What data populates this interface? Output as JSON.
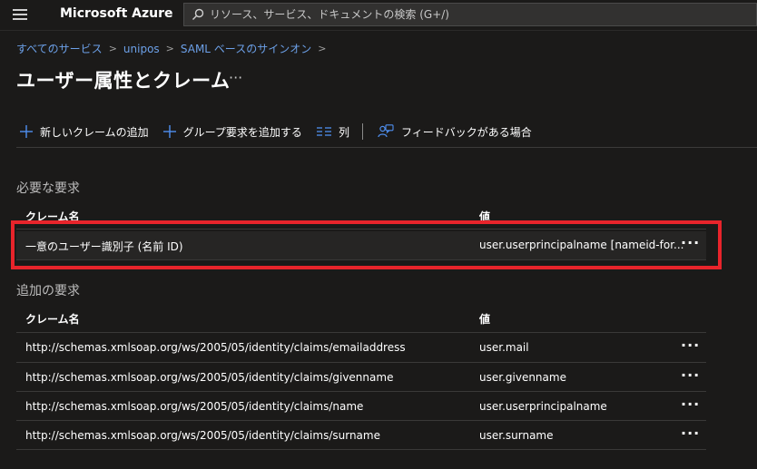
{
  "topbar": {
    "brand": "Microsoft Azure",
    "search_placeholder": "リソース、サービス、ドキュメントの検索 (G+/)"
  },
  "breadcrumb": {
    "items": [
      "すべてのサービス",
      "unipos",
      "SAML ベースのサインオン"
    ],
    "separator": ">"
  },
  "page": {
    "title": "ユーザー属性とクレーム",
    "more": "···"
  },
  "toolbar": {
    "add_claim": "新しいクレームの追加",
    "add_group_claim": "グループ要求を追加する",
    "columns": "列",
    "feedback": "フィードバックがある場合"
  },
  "required": {
    "title": "必要な要求",
    "col_name": "クレーム名",
    "col_value": "値",
    "rows": [
      {
        "name": "一意のユーザー識別子 (名前 ID)",
        "value": "user.userprincipalname [nameid-for...",
        "more": "···"
      }
    ]
  },
  "additional": {
    "title": "追加の要求",
    "col_name": "クレーム名",
    "col_value": "値",
    "rows": [
      {
        "name": "http://schemas.xmlsoap.org/ws/2005/05/identity/claims/emailaddress",
        "value": "user.mail",
        "more": "···"
      },
      {
        "name": "http://schemas.xmlsoap.org/ws/2005/05/identity/claims/givenname",
        "value": "user.givenname",
        "more": "···"
      },
      {
        "name": "http://schemas.xmlsoap.org/ws/2005/05/identity/claims/name",
        "value": "user.userprincipalname",
        "more": "···"
      },
      {
        "name": "http://schemas.xmlsoap.org/ws/2005/05/identity/claims/surname",
        "value": "user.surname",
        "more": "···"
      }
    ]
  },
  "colors": {
    "accent_link": "#6ca0e8",
    "highlight": "#e8242b",
    "icon_blue": "#4f8ff0"
  }
}
